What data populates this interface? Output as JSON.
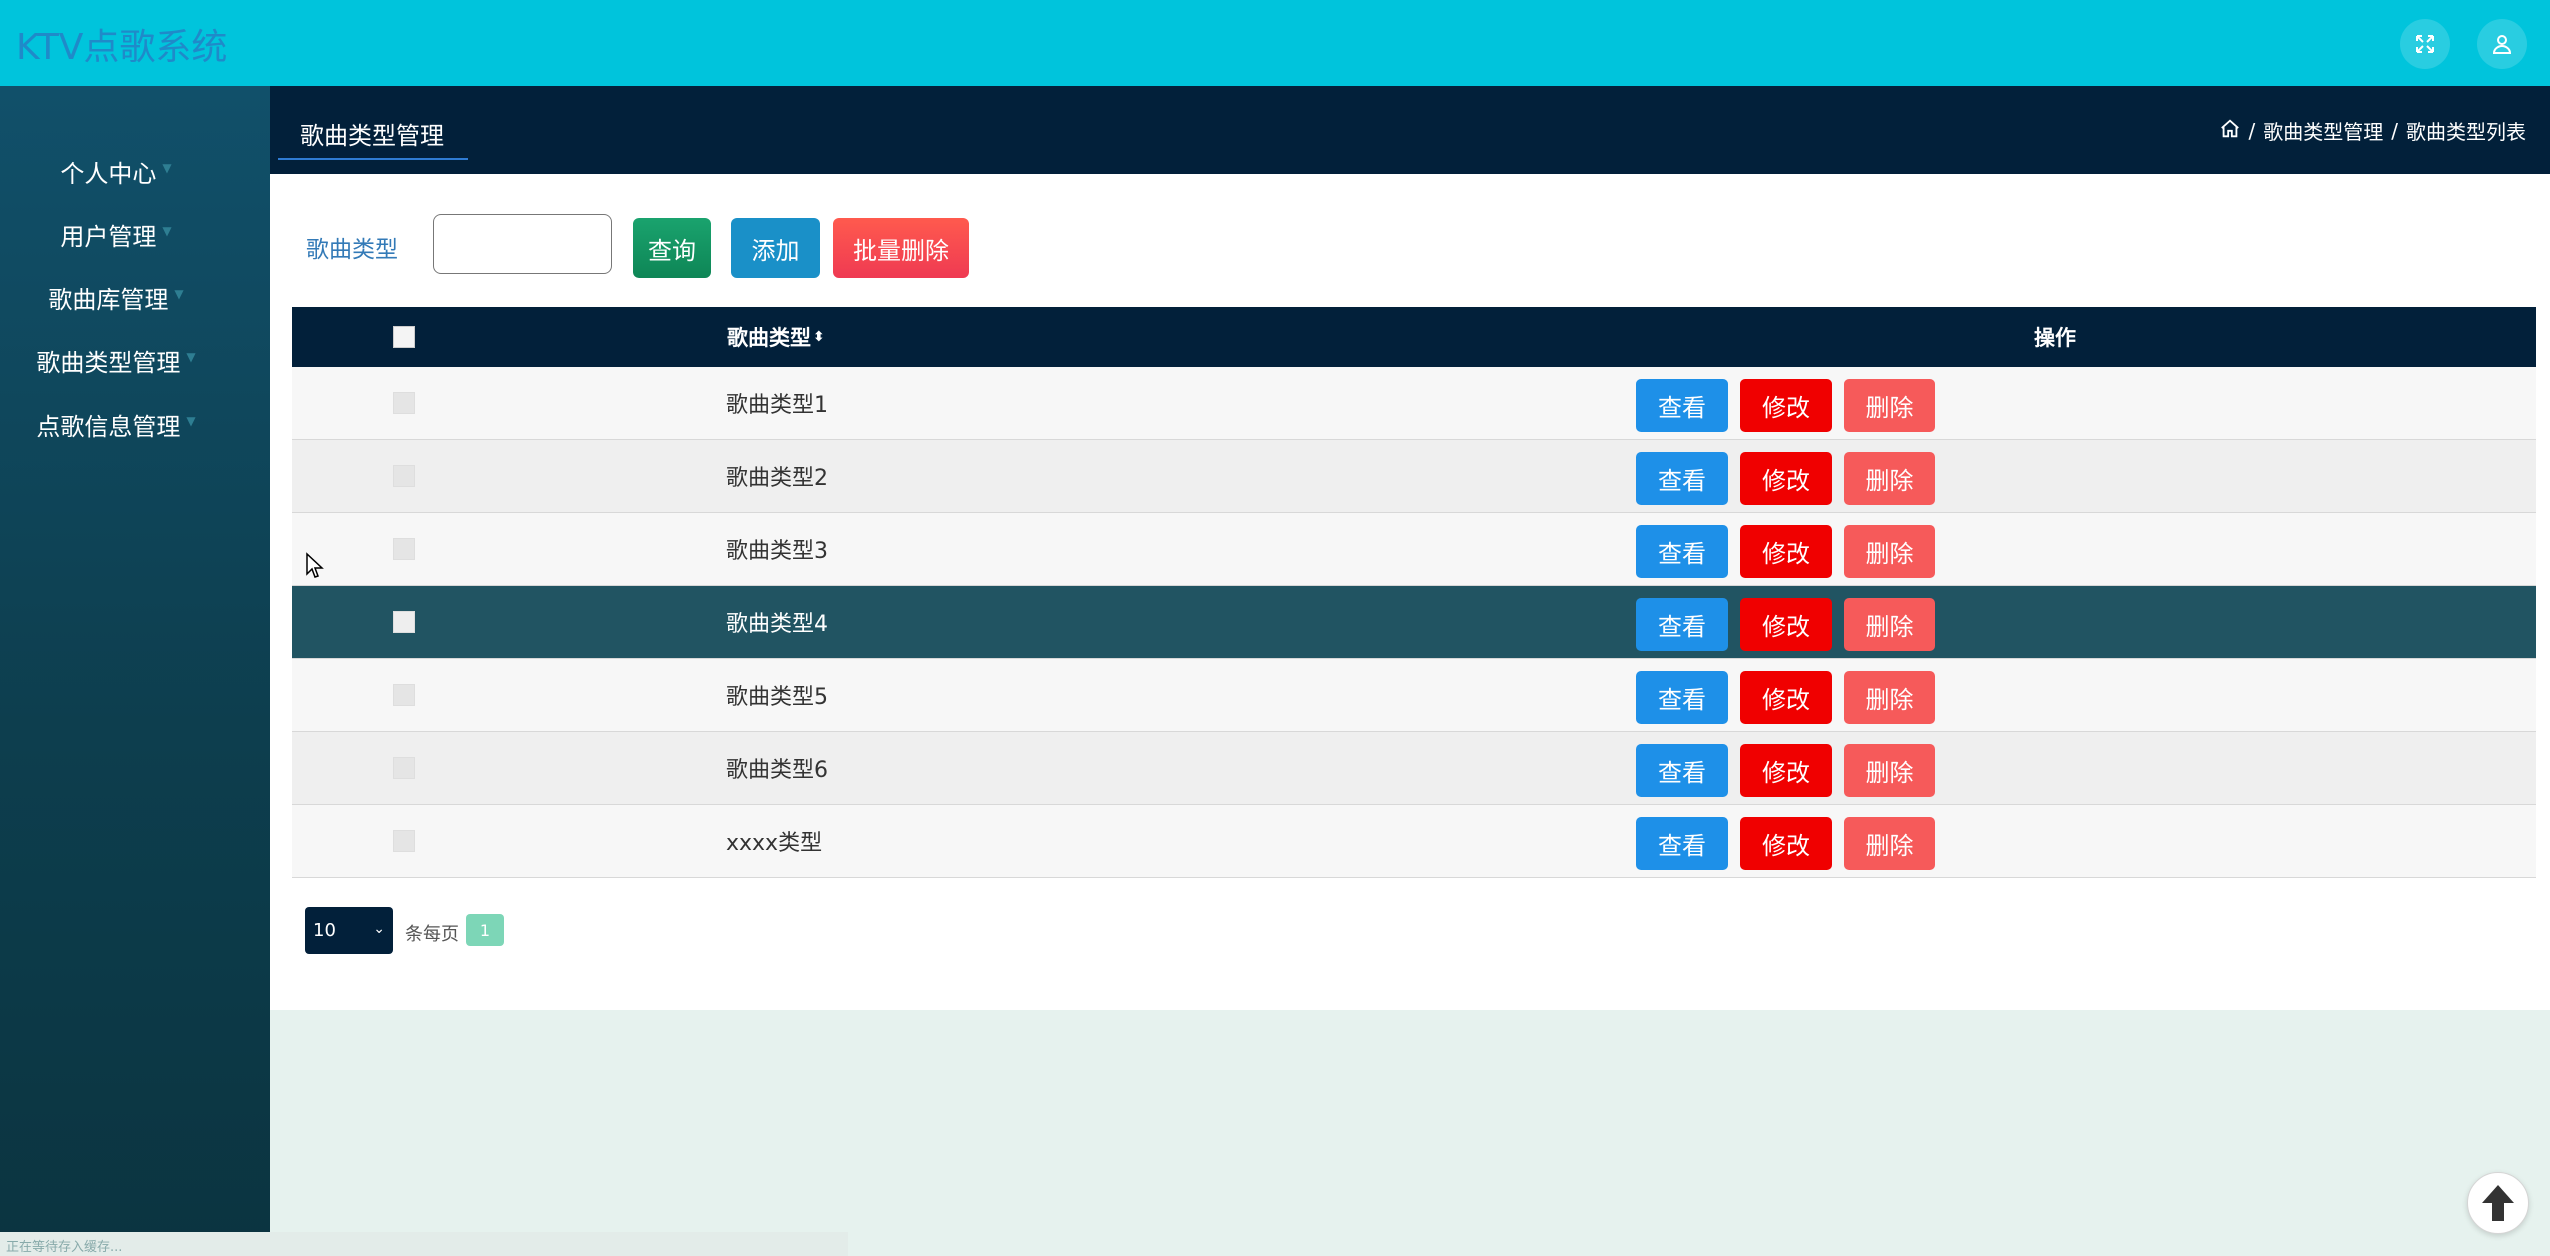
{
  "app": {
    "title": "KTV点歌系统"
  },
  "topbar": {
    "fullscreen_icon": "fullscreen-icon",
    "user_icon": "user-icon"
  },
  "sidebar": {
    "items": [
      {
        "label": "个人中心"
      },
      {
        "label": "用户管理"
      },
      {
        "label": "歌曲库管理"
      },
      {
        "label": "歌曲类型管理"
      },
      {
        "label": "点歌信息管理"
      }
    ]
  },
  "header": {
    "tab": "歌曲类型管理",
    "breadcrumb": [
      "歌曲类型管理",
      "歌曲类型列表"
    ],
    "separator": "/"
  },
  "search": {
    "label": "歌曲类型",
    "value": "",
    "query_label": "查询",
    "add_label": "添加",
    "batch_delete_label": "批量删除"
  },
  "table": {
    "columns": {
      "type": "歌曲类型",
      "sort_glyph": "⬍",
      "operation": "操作"
    },
    "action_labels": {
      "view": "查看",
      "edit": "修改",
      "delete": "删除"
    },
    "rows": [
      {
        "type": "歌曲类型1"
      },
      {
        "type": "歌曲类型2"
      },
      {
        "type": "歌曲类型3"
      },
      {
        "type": "歌曲类型4"
      },
      {
        "type": "歌曲类型5"
      },
      {
        "type": "歌曲类型6"
      },
      {
        "type": "xxxx类型"
      }
    ],
    "highlighted_row": 4
  },
  "pagination": {
    "page_size": "10",
    "per_page_label": "条每页",
    "current_page": "1"
  },
  "statusbar": {
    "text": "正在等待存入缓存..."
  },
  "colors": {
    "topbar": "#00c4dc",
    "header": "#02203a",
    "sidebar": "#11506a",
    "view": "#1e90e8",
    "edit": "#f00000",
    "delete": "#f65a5a"
  }
}
